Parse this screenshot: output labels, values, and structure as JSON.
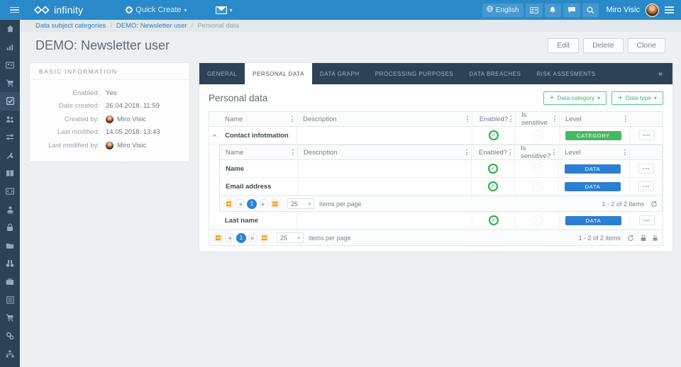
{
  "topbar": {
    "brand": "infinity",
    "quick_create": "Quick Create",
    "language": "English",
    "username": "Miro Visic",
    "icons": [
      "globe-icon",
      "id-card-icon",
      "bell-icon",
      "chat-icon",
      "search-icon"
    ]
  },
  "breadcrumb": {
    "items": [
      "Data subject categories",
      "DEMO: Newsletter user",
      "Personal data"
    ]
  },
  "page": {
    "title": "DEMO: Newsletter user",
    "actions": [
      "Edit",
      "Delete",
      "Clone"
    ]
  },
  "basic_information": {
    "header": "BASIC INFORMATION",
    "rows": [
      {
        "label": "Enabled:",
        "value": "Yes",
        "avatar": false
      },
      {
        "label": "Date created:",
        "value": "26.04.2018. 11:59",
        "avatar": false
      },
      {
        "label": "Created by:",
        "value": "Miro Visic",
        "avatar": true
      },
      {
        "label": "Last modified:",
        "value": "14.05.2018. 13:43",
        "avatar": false
      },
      {
        "label": "Last modified by:",
        "value": "Miro Visic",
        "avatar": true
      }
    ]
  },
  "tabs": [
    {
      "label": "GENERAL",
      "active": false
    },
    {
      "label": "PERSONAL DATA",
      "active": true
    },
    {
      "label": "DATA GRAPH",
      "active": false
    },
    {
      "label": "PROCESSING PURPOSES",
      "active": false
    },
    {
      "label": "DATA BREACHES",
      "active": false
    },
    {
      "label": "RISK ASSESMENTS",
      "active": false
    }
  ],
  "panel": {
    "title": "Personal data",
    "buttons": [
      {
        "label": "Data category"
      },
      {
        "label": "Data type"
      }
    ]
  },
  "outer_grid": {
    "headers": {
      "name": "Name",
      "description": "Description",
      "enabled": "Enabled?",
      "sensitive": "Is sensitive",
      "level": "Level"
    },
    "rows": [
      {
        "name": "Contact infotmation",
        "description": "",
        "enabled": true,
        "sensitive": false,
        "level": "CATEGORY",
        "level_type": "cat",
        "expanded": true
      },
      {
        "name": "Last name",
        "description": "",
        "enabled": true,
        "sensitive": false,
        "level": "DATA",
        "level_type": "data",
        "expanded": false
      }
    ]
  },
  "inner_grid": {
    "headers": {
      "name": "Name",
      "description": "Description",
      "enabled": "Enabled?",
      "sensitive": "Is sensitive?",
      "level": "Level"
    },
    "rows": [
      {
        "name": "Name",
        "description": "",
        "enabled": true,
        "sensitive": false,
        "level": "DATA"
      },
      {
        "name": "Email address",
        "description": "",
        "enabled": true,
        "sensitive": false,
        "level": "DATA"
      }
    ],
    "pager": {
      "page": "1",
      "page_size": "25",
      "items_per_page_label": "items per page",
      "range": "1 - 2 of 2 items"
    }
  },
  "outer_pager": {
    "page": "1",
    "page_size": "25",
    "items_per_page_label": "items per page",
    "range": "1 - 2 of 2 items"
  },
  "sidebar": {
    "items": [
      {
        "name": "home-icon",
        "active": false
      },
      {
        "name": "chart-icon",
        "active": false
      },
      {
        "name": "id-card-icon",
        "active": false
      },
      {
        "name": "cart-icon",
        "active": false
      },
      {
        "name": "checkbox-icon",
        "active": true
      },
      {
        "name": "users-icon",
        "active": false
      },
      {
        "name": "sliders-icon",
        "active": false
      },
      {
        "name": "tools-icon",
        "active": false
      },
      {
        "name": "book-icon",
        "active": false
      },
      {
        "name": "code-icon",
        "active": false
      },
      {
        "name": "person-pin-icon",
        "active": false
      },
      {
        "name": "lock-icon",
        "active": false
      },
      {
        "name": "folder-icon",
        "active": false
      },
      {
        "name": "binoculars-icon",
        "active": false
      },
      {
        "name": "briefcase-icon",
        "active": false
      },
      {
        "name": "list-icon",
        "active": false
      },
      {
        "name": "cart2-icon",
        "active": false
      },
      {
        "name": "gears-icon",
        "active": false
      },
      {
        "name": "sitemap-icon",
        "active": false
      }
    ]
  },
  "colors": {
    "accent_blue": "#2a8ac9",
    "sidebar_navy": "#2e4257",
    "green": "#46b963",
    "data_blue": "#2d7fd3",
    "check_green": "#27ae44"
  }
}
